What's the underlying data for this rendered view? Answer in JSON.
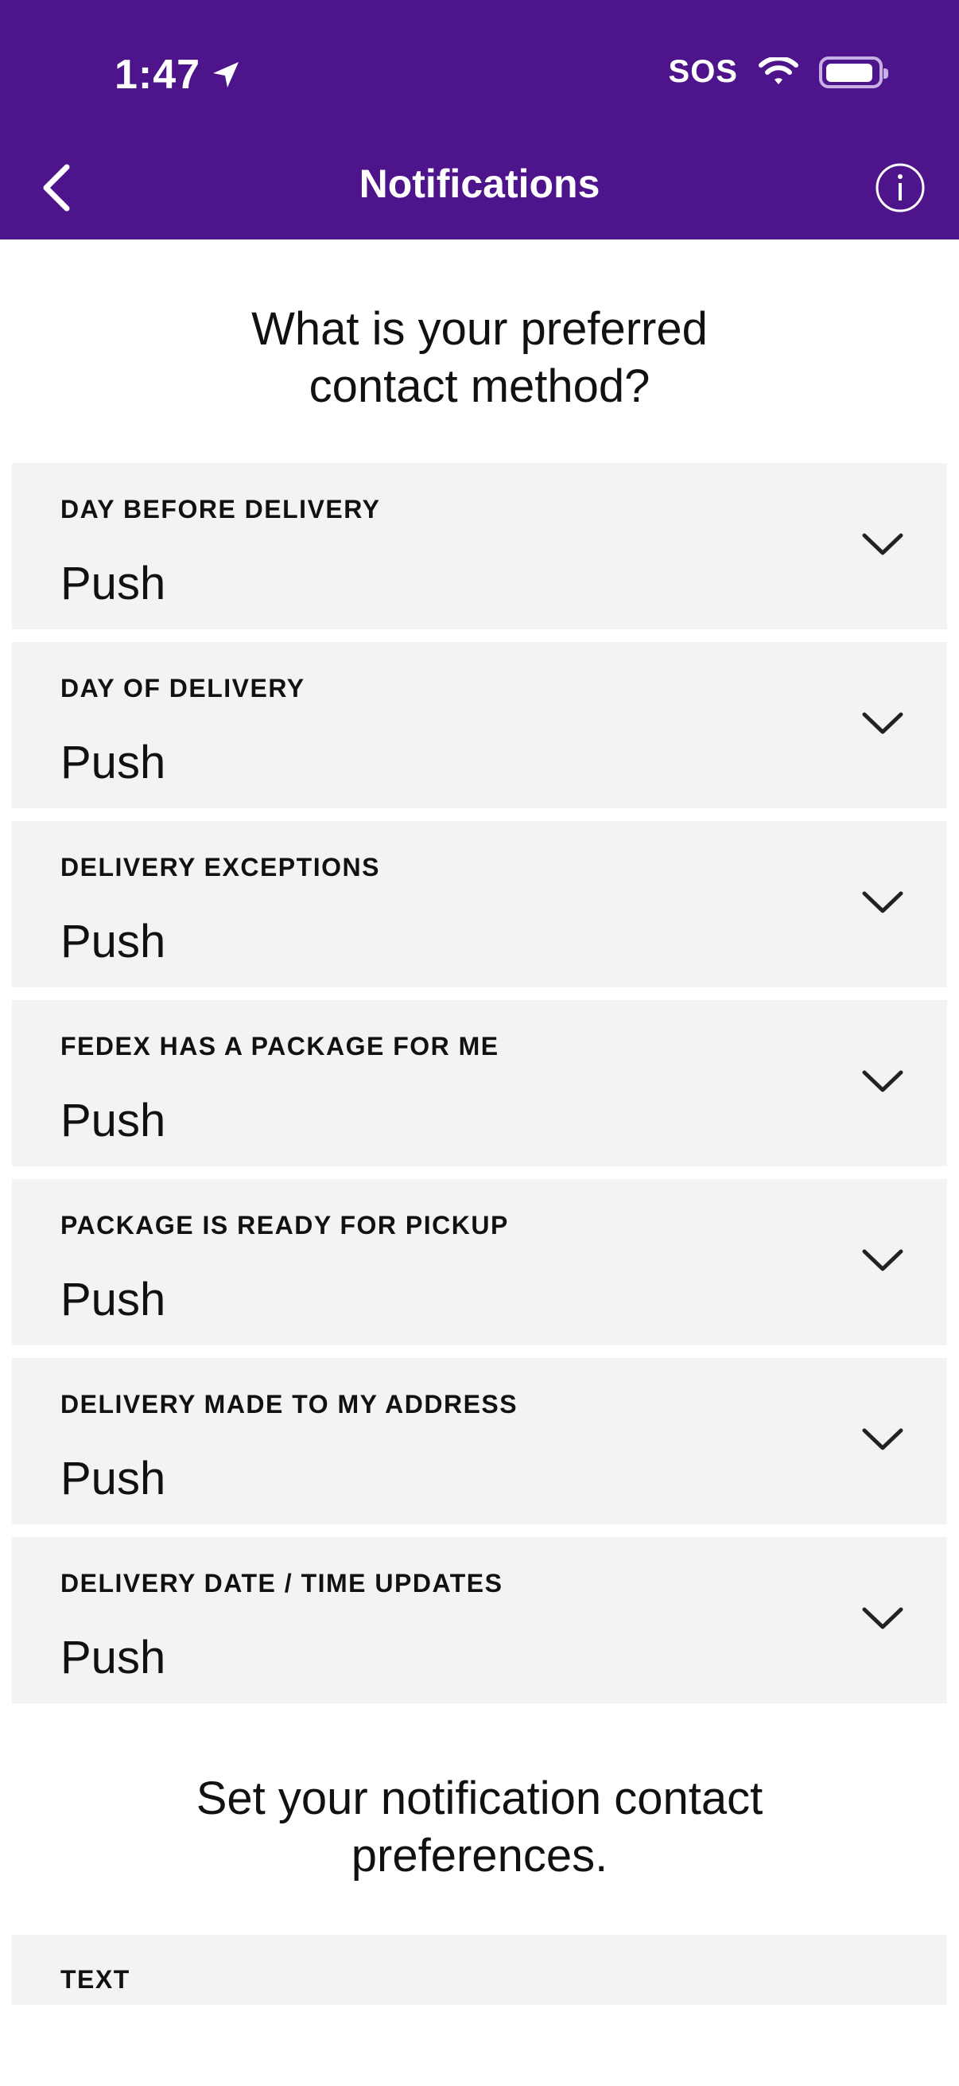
{
  "status_bar": {
    "time": "1:47",
    "sos": "SOS"
  },
  "header": {
    "title": "Notifications"
  },
  "question": {
    "line1": "What is your preferred",
    "line2": "contact method?"
  },
  "notification_rows": [
    {
      "label": "DAY BEFORE DELIVERY",
      "value": "Push"
    },
    {
      "label": "DAY OF DELIVERY",
      "value": "Push"
    },
    {
      "label": "DELIVERY EXCEPTIONS",
      "value": "Push"
    },
    {
      "label": "FEDEX HAS A PACKAGE FOR ME",
      "value": "Push"
    },
    {
      "label": "PACKAGE IS READY FOR PICKUP",
      "value": "Push"
    },
    {
      "label": "DELIVERY MADE TO MY ADDRESS",
      "value": "Push"
    },
    {
      "label": "DELIVERY DATE / TIME UPDATES",
      "value": "Push"
    }
  ],
  "preferences": {
    "line1": "Set your notification contact",
    "line2": "preferences."
  },
  "contact_section": {
    "label": "TEXT"
  },
  "colors": {
    "header_bg": "#4d148c",
    "row_bg": "#f3f3f3"
  }
}
